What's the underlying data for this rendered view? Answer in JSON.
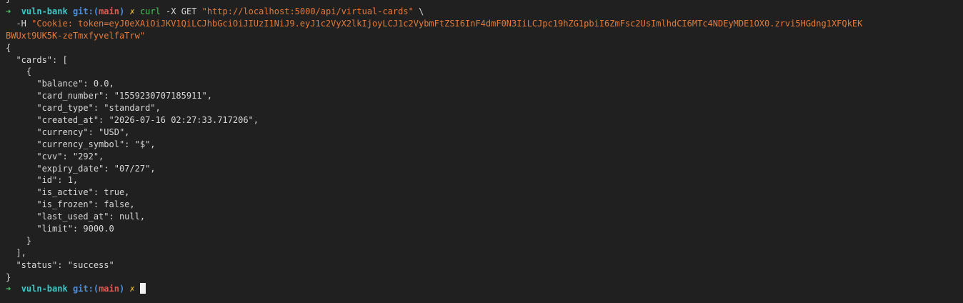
{
  "colors": {
    "background": "#202020",
    "text": "#d8d8d8",
    "prompt_arrow": "#4fc26a",
    "prompt_dir": "#3fc7c7",
    "prompt_git": "#4c8fe0",
    "prompt_branch": "#e05a4f",
    "prompt_dirty": "#e0b83c",
    "command": "#49c25c",
    "string": "#e37a3a"
  },
  "scrollback": "}",
  "prompt": {
    "arrow": "➜",
    "dir": "vuln-bank",
    "git_open": "git:(",
    "branch": "main",
    "git_close": ")",
    "dirty": "✗"
  },
  "command": {
    "name": "curl",
    "args": " -X GET ",
    "url": "\"http://localhost:5000/api/virtual-cards\"",
    "continuation": " \\",
    "header_flag": "  -H ",
    "cookie_part1": "\"Cookie: token=eyJ0eXAiOiJKV1QiLCJhbGciOiJIUzI1NiJ9.eyJ1c2VyX2lkIjoyLCJ1c2VybmFtZSI6InF4dmF0N3IiLCJpc19hZG1pbiI6ZmFsc2UsImlhdCI6MTc4NDEyMDE1OX0.zrvi5HGdng1XFQkEK",
    "cookie_part2": "BWUxt9UK5K-zeTmxfyvelfaTrw\""
  },
  "output": [
    "{",
    "  \"cards\": [",
    "    {",
    "      \"balance\": 0.0,",
    "      \"card_number\": \"1559230707185911\",",
    "      \"card_type\": \"standard\",",
    "      \"created_at\": \"2026-07-16 02:27:33.717206\",",
    "      \"currency\": \"USD\",",
    "      \"currency_symbol\": \"$\",",
    "      \"cvv\": \"292\",",
    "      \"expiry_date\": \"07/27\",",
    "      \"id\": 1,",
    "      \"is_active\": true,",
    "      \"is_frozen\": false,",
    "      \"last_used_at\": null,",
    "      \"limit\": 9000.0",
    "    }",
    "  ],",
    "  \"status\": \"success\"",
    "}"
  ]
}
